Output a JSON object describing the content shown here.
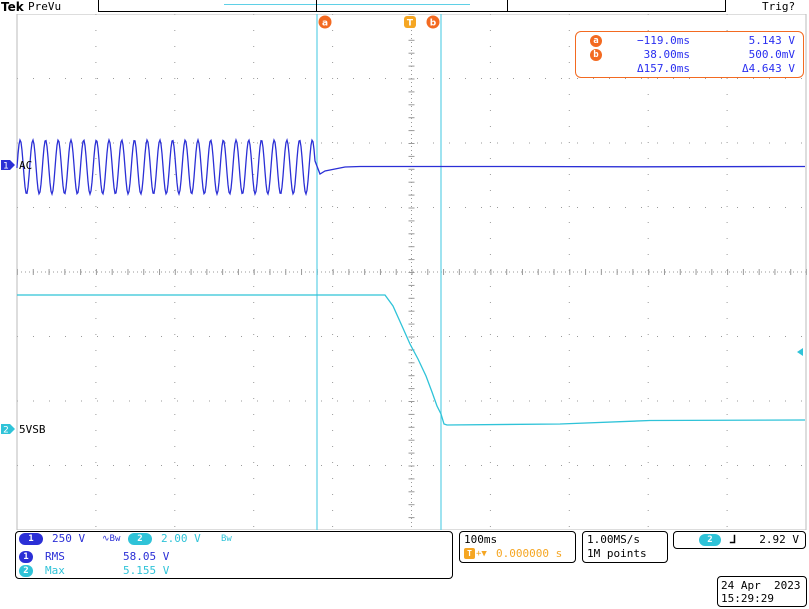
{
  "top": {
    "brand": "Tek",
    "mode": "PreVu",
    "trigger_status": "Trig?"
  },
  "colors": {
    "ch1": "#2b2fd6",
    "ch2": "#2fc3d8",
    "cursor": "#5fd0e6",
    "accent": "#f36a21",
    "grid": "#9a9a9a"
  },
  "cursors": {
    "a_label": "a",
    "b_label": "b",
    "trigger_label": "T",
    "readout": {
      "a_time": "−119.0ms",
      "a_value": "5.143 V",
      "b_time": "38.00ms",
      "b_value": "500.0mV",
      "delta_time": "Δ157.0ms",
      "delta_value": "Δ4.643 V"
    }
  },
  "channels": {
    "ch1_number": "1",
    "ch1_label": "AC",
    "ch2_number": "2",
    "ch2_label": "5VSB"
  },
  "bottom": {
    "ch1_scale": "250 V",
    "ch1_coupling_glyph": "∿Bw",
    "ch2_scale": "2.00 V",
    "ch2_coupling_glyph": "Bw",
    "meas1_name": "RMS",
    "meas1_value": "58.05 V",
    "meas2_name": "Max",
    "meas2_value": "5.155 V",
    "timebase": "100ms",
    "trigger_position": "0.000000 s",
    "sample_rate": "1.00MS/s",
    "record_length": "1M points",
    "trigger_source": "2",
    "trigger_slope_glyph": "⅃",
    "trigger_level": "2.92 V",
    "date": "24 Apr  2023",
    "time": "15:29:29"
  }
}
